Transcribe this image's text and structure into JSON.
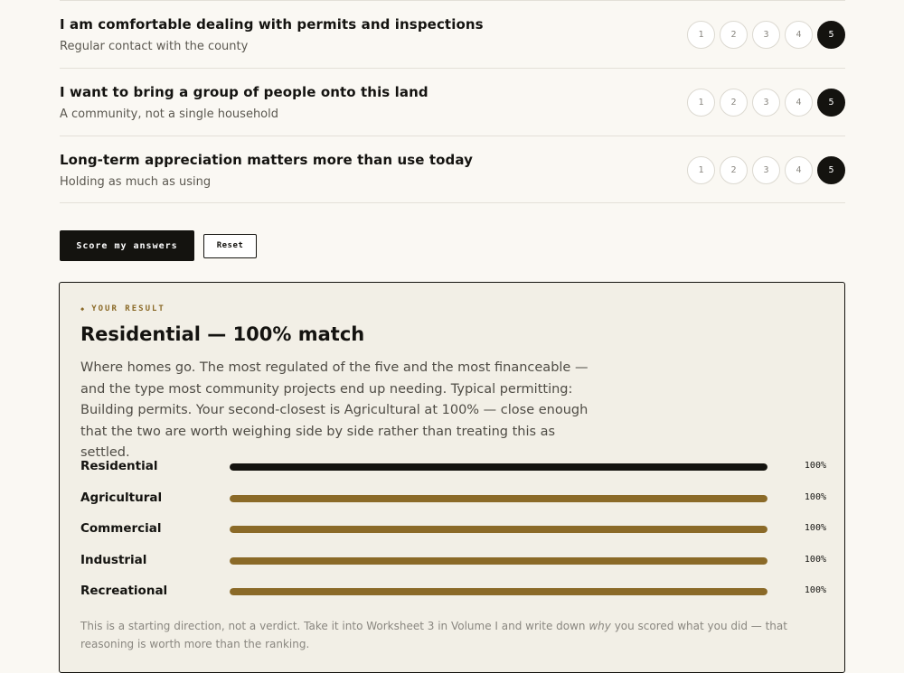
{
  "questions": [
    {
      "title": "I am comfortable dealing with permits and inspections",
      "subtitle": "Regular contact with the county",
      "options": [
        "1",
        "2",
        "3",
        "4",
        "5"
      ],
      "selected": 5
    },
    {
      "title": "I want to bring a group of people onto this land",
      "subtitle": "A community, not a single household",
      "options": [
        "1",
        "2",
        "3",
        "4",
        "5"
      ],
      "selected": 5
    },
    {
      "title": "Long-term appreciation matters more than use today",
      "subtitle": "Holding as much as using",
      "options": [
        "1",
        "2",
        "3",
        "4",
        "5"
      ],
      "selected": 5
    }
  ],
  "actions": {
    "score_label": "Score my answers",
    "reset_label": "Reset"
  },
  "result": {
    "eyebrow": "YOUR RESULT",
    "eyebrow_icon": "diamond-icon",
    "title": "Residential — 100% match",
    "description": "Where homes go. The most regulated of the five and the most financeable — and the type most community projects end up needing. Typical permitting: Building permits. Your second-closest is Agricultural at 100% — close enough that the two are worth weighing side by side rather than treating this as settled.",
    "scores": [
      {
        "label": "Residential",
        "value": 100,
        "pct_text": "100%"
      },
      {
        "label": "Agricultural",
        "value": 100,
        "pct_text": "100%"
      },
      {
        "label": "Commercial",
        "value": 100,
        "pct_text": "100%"
      },
      {
        "label": "Industrial",
        "value": 100,
        "pct_text": "100%"
      },
      {
        "label": "Recreational",
        "value": 100,
        "pct_text": "100%"
      }
    ],
    "note_before": "This is a starting direction, not a verdict. Take it into Worksheet 3 in Volume I and write down ",
    "note_em": "why",
    "note_after": " you scored what you did — that reasoning is worth more than the ranking."
  },
  "colors": {
    "accent": "#8b6a28",
    "ink": "#14130f",
    "background": "#faf8f3",
    "panel": "#f2efe6"
  }
}
